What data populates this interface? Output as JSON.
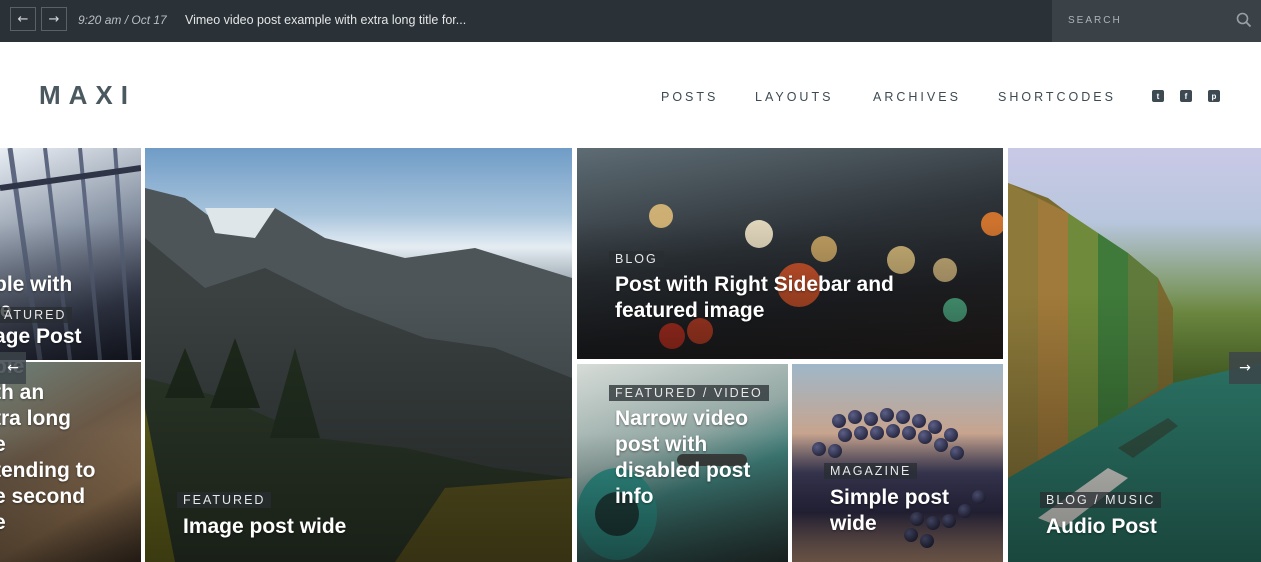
{
  "topbar": {
    "prev_icon": "arrow-left-icon",
    "next_icon": "arrow-right-icon",
    "ticker_time": "9:20 am / Oct 17",
    "ticker_title": "Vimeo video post example with extra long title for...",
    "search_placeholder": "SEARCH"
  },
  "header": {
    "logo": "MAXI",
    "nav": [
      "POSTS",
      "LAYOUTS",
      "ARCHIVES",
      "SHORTCODES"
    ],
    "social": {
      "twitter": "t",
      "facebook": "f",
      "pinterest": "p"
    }
  },
  "grid": {
    "left_top_title": "ple with\nle\nage Post",
    "left_top_cat": "ATURED",
    "left_bottom_title": "ple\nth an\ntra long\ne\ntending to\ne second\ne",
    "mountain_cat": "FEATURED",
    "mountain_title": "Image post wide",
    "bokeh_cat": "BLOG",
    "bokeh_title": "Post with Right Sidebar and featured image",
    "scooter_cat": "FEATURED / VIDEO",
    "scooter_title": "Narrow video post with disabled post info",
    "grapes_cat": "MAGAZINE",
    "grapes_title": "Simple post wide",
    "canal_cat": "BLOG / MUSIC",
    "canal_title": "Audio Post"
  },
  "slider": {
    "prev_icon": "arrow-left-icon",
    "next_icon": "arrow-right-icon"
  },
  "colors": {
    "topbar": "#2b3237",
    "logo": "#4a5860",
    "nav": "#3d4a52"
  }
}
